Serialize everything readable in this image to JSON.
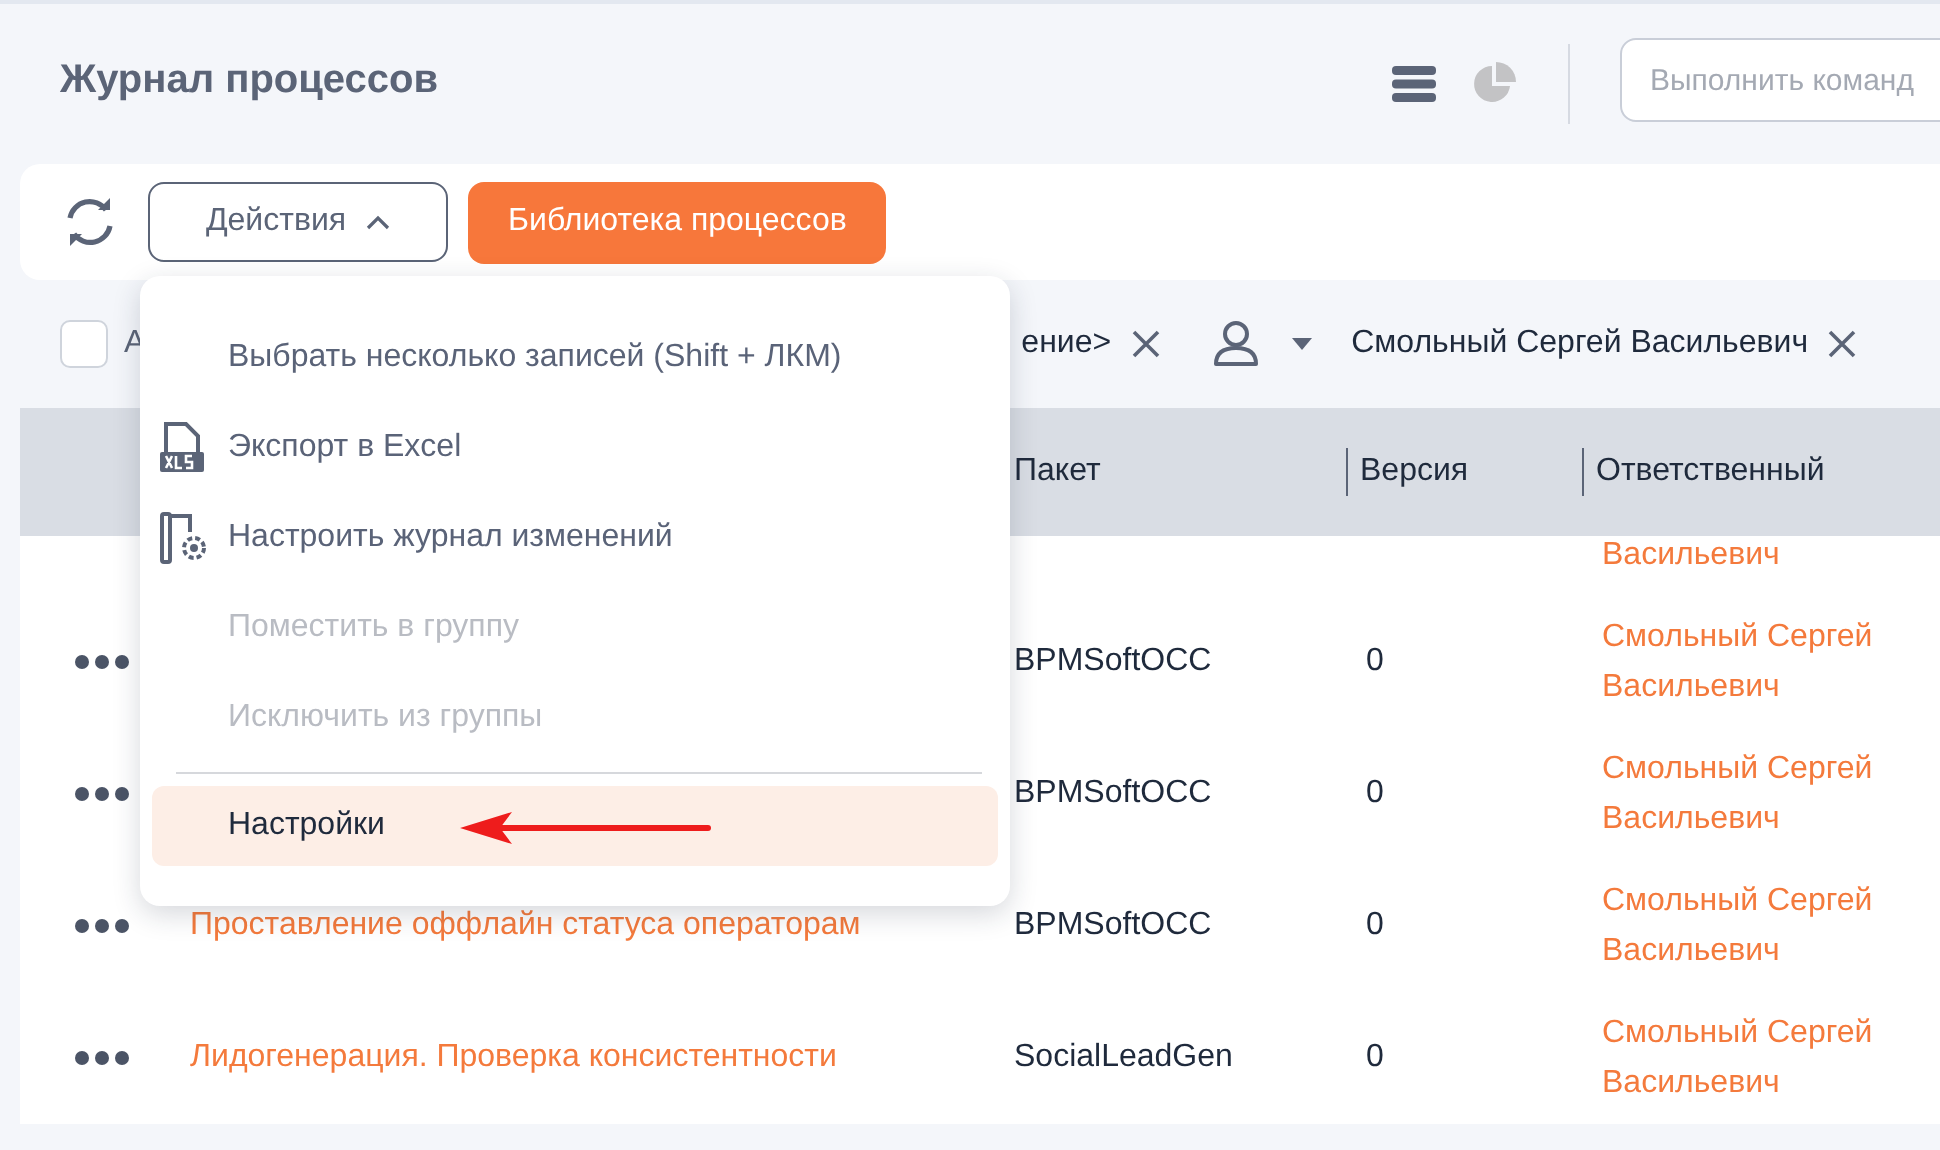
{
  "header": {
    "title": "Журнал процессов",
    "command": {
      "placeholder": "Выполнить команд"
    }
  },
  "toolbar": {
    "actions": {
      "label": "Действия",
      "expanded": true
    },
    "library": {
      "label": "Библиотека процессов"
    }
  },
  "filters": {
    "select_all": {
      "label": "А",
      "checked": false
    },
    "chips": [
      {
        "kind": "text",
        "label": "ение>"
      },
      {
        "kind": "owner",
        "label": "Смольный Сергей Васильевич"
      }
    ]
  },
  "table": {
    "columns": [
      {
        "label": "Пакет"
      },
      {
        "label": "Версия"
      },
      {
        "label": "Ответственный"
      }
    ],
    "rows": [
      {
        "kind": "partial",
        "responsible": "Васильевич"
      },
      {
        "kind": "full",
        "package": "BPMSoftOCC",
        "version": "0",
        "responsible": "Смольный Сергей Васильевич"
      },
      {
        "kind": "full",
        "package": "BPMSoftOCC",
        "version": "0",
        "responsible": "Смольный Сергей Васильевич"
      },
      {
        "kind": "full",
        "name": "Проставление оффлайн статуса операторам",
        "package": "BPMSoftOCC",
        "version": "0",
        "responsible": "Смольный Сергей Васильевич"
      },
      {
        "kind": "full",
        "name": "Лидогенерация. Проверка консистентности",
        "package": "SocialLeadGen",
        "version": "0",
        "responsible": "Смольный Сергей Васильевич"
      }
    ]
  },
  "actions_menu": {
    "items": [
      {
        "kind": "plain",
        "label": "Выбрать несколько записей (Shift + ЛКМ)",
        "disabled": false,
        "selected": false
      },
      {
        "kind": "export",
        "label": "Экспорт в Excel",
        "disabled": false,
        "selected": false
      },
      {
        "kind": "configure",
        "label": "Настроить журнал изменений",
        "disabled": false,
        "selected": false
      },
      {
        "kind": "plain",
        "label": "Поместить в группу",
        "disabled": true,
        "selected": false
      },
      {
        "kind": "plain",
        "label": "Исключить из группы",
        "disabled": true,
        "selected": false
      },
      {
        "kind": "divider"
      },
      {
        "kind": "plain",
        "label": "Настройки",
        "disabled": false,
        "selected": true
      }
    ]
  }
}
